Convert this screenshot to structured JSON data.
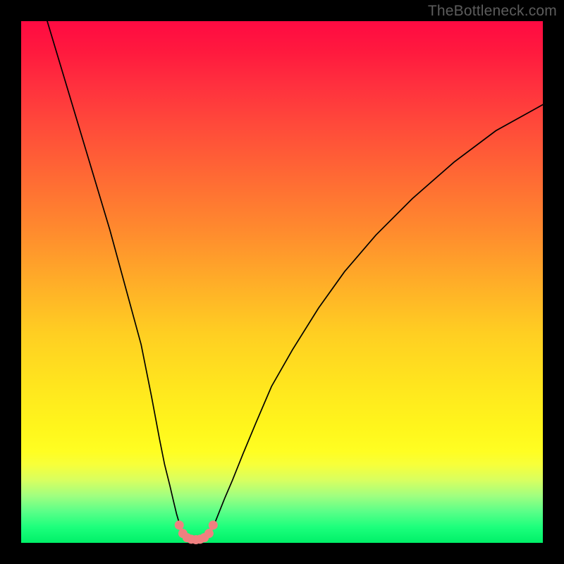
{
  "watermark": "TheBottleneck.com",
  "chart_data": {
    "type": "line",
    "title": "",
    "xlabel": "",
    "ylabel": "",
    "xlim": [
      0,
      100
    ],
    "ylim": [
      0,
      100
    ],
    "grid": false,
    "legend": false,
    "series": [
      {
        "name": "left-branch",
        "x": [
          5,
          8,
          11,
          14,
          17,
          20,
          23,
          25,
          26.5,
          27.5,
          28.5,
          29.2,
          29.8,
          30.3,
          30.7,
          31
        ],
        "y": [
          100,
          90,
          80,
          70,
          60,
          49,
          38,
          28,
          20,
          15,
          11,
          8,
          5.5,
          3.8,
          2.5,
          1.6
        ]
      },
      {
        "name": "right-branch",
        "x": [
          36,
          36.5,
          37.2,
          38,
          39,
          40.5,
          42.5,
          45,
          48,
          52,
          57,
          62,
          68,
          75,
          83,
          91,
          100
        ],
        "y": [
          1.6,
          2.6,
          4,
          6,
          8.5,
          12,
          17,
          23,
          30,
          37,
          45,
          52,
          59,
          66,
          73,
          79,
          84
        ]
      },
      {
        "name": "valley-floor",
        "x": [
          31,
          31.8,
          32.6,
          33.5,
          34.3,
          35.1,
          36
        ],
        "y": [
          1.6,
          1.0,
          0.7,
          0.6,
          0.7,
          1.0,
          1.6
        ]
      }
    ],
    "markers": {
      "x": [
        30.3,
        31.0,
        31.8,
        32.6,
        33.5,
        34.3,
        35.1,
        36.0,
        36.8
      ],
      "y": [
        3.4,
        1.8,
        1.0,
        0.7,
        0.6,
        0.7,
        1.0,
        1.8,
        3.4
      ],
      "r": 6,
      "color": "#f08080"
    },
    "background_gradient": {
      "top": "#ff0a42",
      "mid": "#ffe61e",
      "bottom": "#00f068"
    }
  }
}
